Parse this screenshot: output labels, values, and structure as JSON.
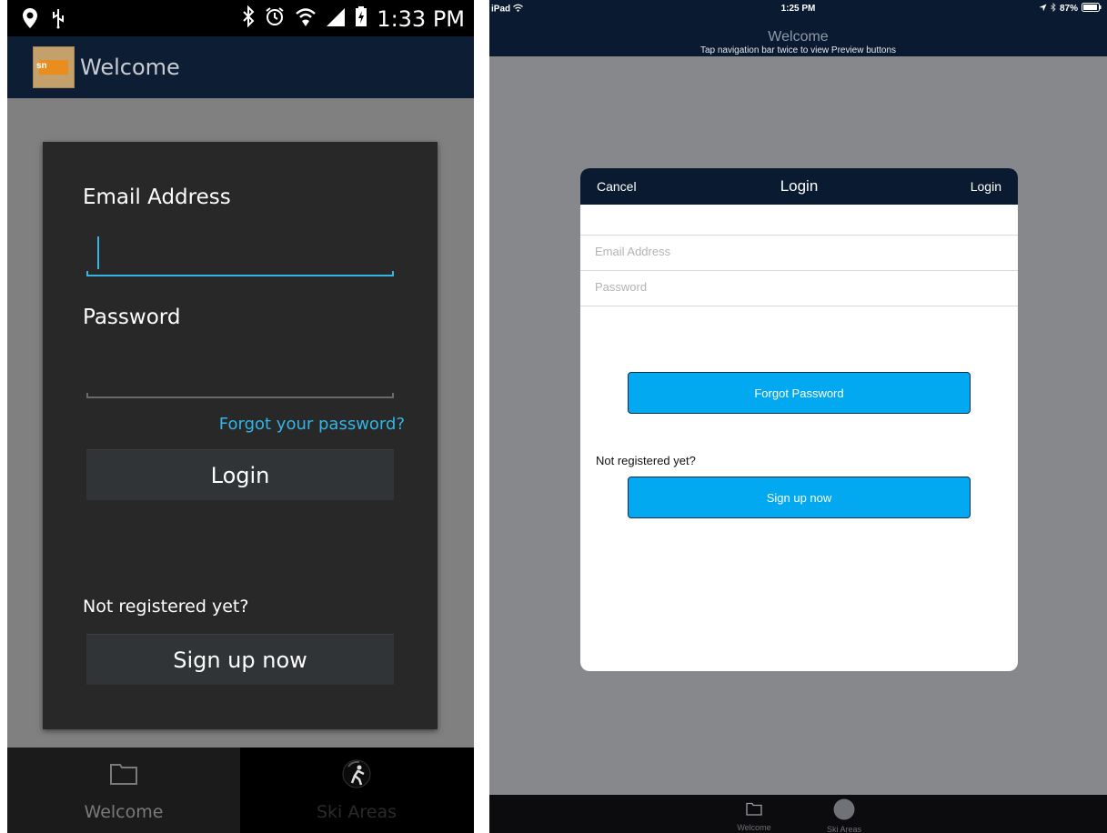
{
  "android": {
    "status_bar": {
      "time": "1:33 PM",
      "icons": [
        "location-icon",
        "usb-icon",
        "bluetooth-icon",
        "alarm-icon",
        "wifi-icon",
        "signal-icon",
        "battery-icon"
      ]
    },
    "app_bar": {
      "title": "Welcome",
      "logo_text": "sn"
    },
    "login_dialog": {
      "email_label": "Email Address",
      "email_value": "",
      "password_label": "Password",
      "password_value": "",
      "forgot_link": "Forgot your password?",
      "login_button": "Login",
      "not_registered": "Not registered yet?",
      "signup_button": "Sign up now"
    },
    "tabs": [
      {
        "label": "Welcome",
        "icon": "folder-icon",
        "active": true
      },
      {
        "label": "Ski Areas",
        "icon": "skier-icon",
        "active": false
      }
    ],
    "colors": {
      "accent": "#33b5e5",
      "app_bar": "#0d1d33",
      "dialog": "#282828"
    }
  },
  "ipad": {
    "status_bar": {
      "device": "iPad",
      "time": "1:25 PM",
      "battery": "87%"
    },
    "nav_bar": {
      "title": "Welcome",
      "subtitle": "Tap navigation bar twice to view Preview buttons"
    },
    "login_sheet": {
      "cancel": "Cancel",
      "title": "Login",
      "login": "Login",
      "email_placeholder": "Email Address",
      "password_placeholder": "Password",
      "forgot_button": "Forgot Password",
      "not_registered": "Not registered yet?",
      "signup_button": "Sign up now"
    },
    "tabs": [
      {
        "label": "Welcome",
        "icon": "folder-icon"
      },
      {
        "label": "Ski Areas",
        "icon": "circle-icon"
      }
    ],
    "colors": {
      "accent": "#03a9f0",
      "nav_bar": "#0a1a31"
    }
  }
}
